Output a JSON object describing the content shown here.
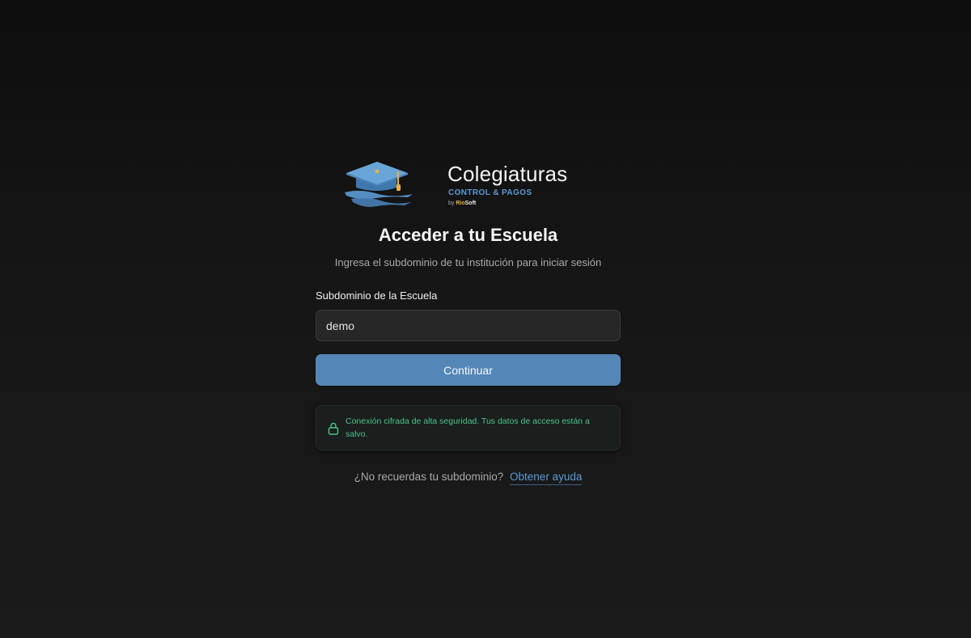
{
  "brand": {
    "name": "Colegiaturas",
    "tagline": "CONTROL & PAGOS",
    "by": "by",
    "maker_a": "Rio",
    "maker_b": "Soft",
    "logo_icon": "graduation-cap-icon"
  },
  "login": {
    "title": "Acceder a tu Escuela",
    "subtitle": "Ingresa el subdominio de tu institución para iniciar sesión",
    "field_label": "Subdominio de la Escuela",
    "field_value": "demo",
    "field_placeholder": "",
    "submit_label": "Continuar"
  },
  "security": {
    "icon": "lock-icon",
    "message": "Conexión cifrada de alta seguridad. Tus datos de acceso están a salvo."
  },
  "help": {
    "question": "¿No recuerdas tu subdominio?",
    "link_label": "Obtener ayuda"
  },
  "colors": {
    "background": "#161616",
    "accent": "#5487b8",
    "brand_blue": "#5b9bd5",
    "brand_gold": "#e8b04a",
    "success": "#4cc38a"
  }
}
